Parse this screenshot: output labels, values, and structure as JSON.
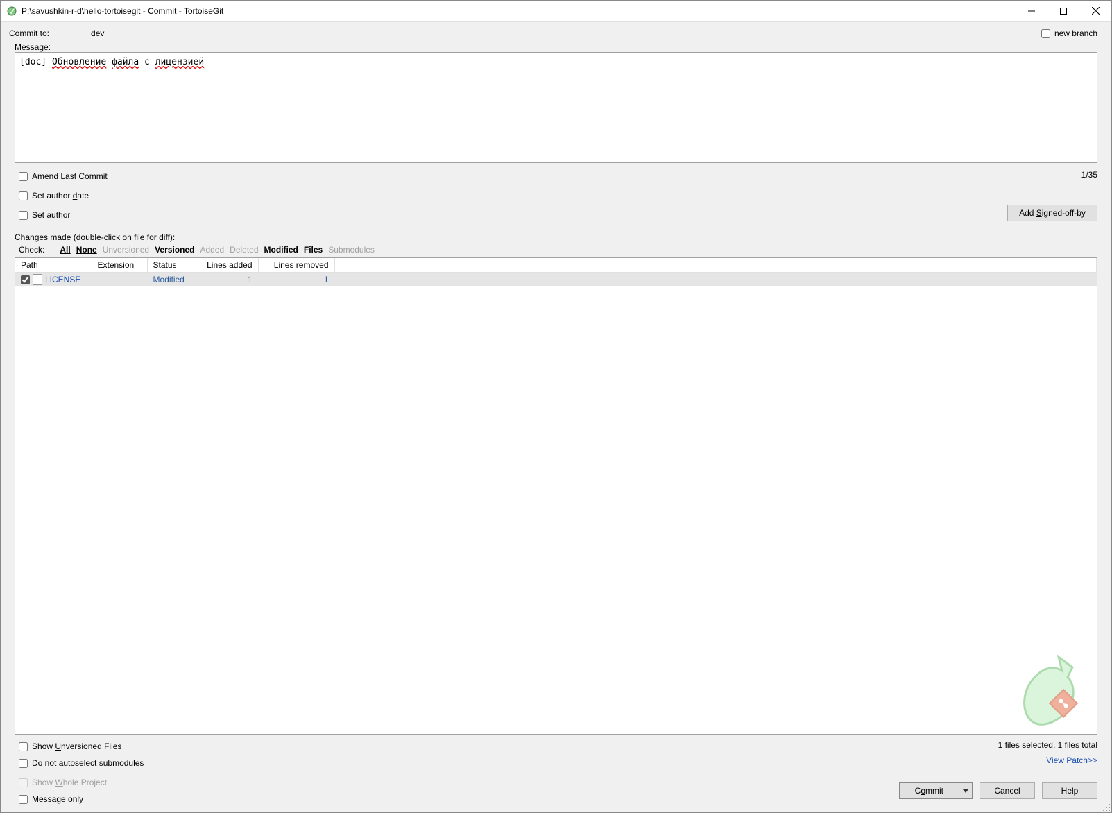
{
  "window": {
    "title": "P:\\savushkin-r-d\\hello-tortoisegit - Commit - TortoiseGit"
  },
  "header": {
    "commit_to_label": "Commit to:",
    "branch": "dev",
    "new_branch_label": "new branch"
  },
  "message": {
    "label": "Message:",
    "text": "[doc] Обновление файла с лицензией",
    "counter": "1/35"
  },
  "options": {
    "amend": "Amend Last Commit",
    "set_author_date": "Set author date",
    "set_author": "Set author",
    "add_signed_off": "Add Signed-off-by"
  },
  "changes": {
    "label": "Changes made (double-click on file for diff):",
    "check_label": "Check:",
    "filters": {
      "all": "All",
      "none": "None",
      "unversioned": "Unversioned",
      "versioned": "Versioned",
      "added": "Added",
      "deleted": "Deleted",
      "modified": "Modified",
      "files": "Files",
      "submodules": "Submodules"
    },
    "columns": {
      "path": "Path",
      "extension": "Extension",
      "status": "Status",
      "lines_added": "Lines added",
      "lines_removed": "Lines removed"
    },
    "rows": [
      {
        "checked": true,
        "path": "LICENSE",
        "extension": "",
        "status": "Modified",
        "lines_added": "1",
        "lines_removed": "1"
      }
    ]
  },
  "below_list": {
    "show_unversioned": "Show Unversioned Files",
    "no_autoselect_submodules": "Do not autoselect submodules",
    "status_text": "1 files selected, 1 files total",
    "view_patch": "View Patch>>"
  },
  "bottom": {
    "show_whole_project": "Show Whole Project",
    "message_only": "Message only",
    "commit": "Commit",
    "cancel": "Cancel",
    "help": "Help"
  }
}
